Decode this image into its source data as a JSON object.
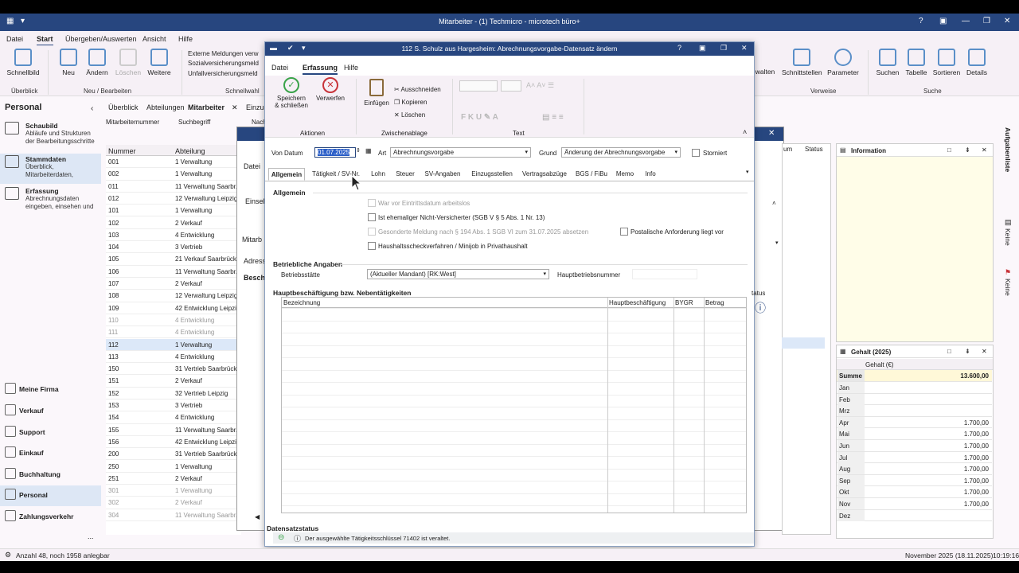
{
  "app": {
    "title": "Mitarbeiter - (1) Techmicro - microtech büro+",
    "menu": [
      "Datei",
      "Start",
      "Übergeben/Auswerten",
      "Ansicht",
      "Hilfe"
    ]
  },
  "ribbon": {
    "buttons": [
      {
        "label": "Schnellbild"
      },
      {
        "label": "Neu"
      },
      {
        "label": "Ändern"
      },
      {
        "label": "Löschen"
      },
      {
        "label": "Weitere"
      }
    ],
    "small": [
      "Externe Meldungen verw",
      "Sozialversicherungsmeld",
      "Unfallversicherungsmeld"
    ],
    "groups": [
      "Überblick",
      "Neu / Bearbeiten",
      "Schnellwahl",
      "Verweise",
      "Suche"
    ],
    "right_buttons": [
      "walten",
      "Schnittstellen",
      "Parameter",
      "Suchen",
      "Tabelle",
      "Sortieren",
      "Details"
    ]
  },
  "sidebar": {
    "header": "Personal",
    "items": [
      {
        "title": "Schaubild",
        "sub": "Abläufe und Strukturen der Bearbeitungsschritte"
      },
      {
        "title": "Stammdaten",
        "sub": "Überblick, Mitarbeiterdaten,"
      },
      {
        "title": "Erfassung",
        "sub": "Abrechnungsdaten eingeben, einsehen und"
      }
    ],
    "nav": [
      "Meine Firma",
      "Verkauf",
      "Support",
      "Einkauf",
      "Buchhaltung",
      "Personal",
      "Zahlungsverkehr"
    ]
  },
  "list": {
    "tabs": [
      "Überblick",
      "Abteilungen",
      "Mitarbeiter",
      "Einzu"
    ],
    "filters": [
      "Mitarbeiternummer",
      "Suchbegriff",
      "Nach"
    ],
    "headers": [
      "Nummer",
      "Abteilung"
    ],
    "rows": [
      [
        "001",
        "1 Verwaltung"
      ],
      [
        "002",
        "1 Verwaltung"
      ],
      [
        "011",
        "11 Verwaltung Saarbr."
      ],
      [
        "012",
        "12 Verwaltung Leipzig"
      ],
      [
        "101",
        "1 Verwaltung"
      ],
      [
        "102",
        "2 Verkauf"
      ],
      [
        "103",
        "4 Entwicklung"
      ],
      [
        "104",
        "3 Vertrieb"
      ],
      [
        "105",
        "21 Verkauf Saarbrück"
      ],
      [
        "106",
        "11 Verwaltung Saarbr."
      ],
      [
        "107",
        "2 Verkauf"
      ],
      [
        "108",
        "12 Verwaltung Leipzig"
      ],
      [
        "109",
        "42 Entwicklung Leipzi"
      ],
      [
        "110",
        "4 Entwicklung"
      ],
      [
        "111",
        "4 Entwicklung"
      ],
      [
        "112",
        "1 Verwaltung"
      ],
      [
        "113",
        "4 Entwicklung"
      ],
      [
        "150",
        "31 Vertrieb Saarbrück"
      ],
      [
        "151",
        "2 Verkauf"
      ],
      [
        "152",
        "32 Vertrieb Leipzig"
      ],
      [
        "153",
        "3 Vertrieb"
      ],
      [
        "154",
        "4 Entwicklung"
      ],
      [
        "155",
        "11 Verwaltung Saarbr."
      ],
      [
        "156",
        "42 Entwicklung Leipzi"
      ],
      [
        "200",
        "31 Vertrieb Saarbrück"
      ],
      [
        "250",
        "1 Verwaltung"
      ],
      [
        "251",
        "2 Verkauf"
      ],
      [
        "301",
        "1 Verwaltung"
      ],
      [
        "302",
        "2 Verkauf"
      ],
      [
        "304",
        "11 Verwaltung Saarbr."
      ]
    ]
  },
  "dlg2": {
    "labels": [
      "Datei",
      "Einseh",
      "Mitarb",
      "Adress",
      "Besch"
    ],
    "cols": [
      "um",
      "Status"
    ],
    "status_col": "tatus"
  },
  "dialog": {
    "title": "112 S. Schulz aus Hargesheim: Abrechnungsvorgabe-Datensatz ändern",
    "menu": [
      "Datei",
      "Erfassung",
      "Hilfe"
    ],
    "ribbon": {
      "save": "Speichern\n& schließen",
      "discard": "Verwerfen",
      "paste": "Einfügen",
      "cut": "Ausschneiden",
      "copy": "Kopieren",
      "delete": "Löschen",
      "groups": [
        "Aktionen",
        "Zwischenablage",
        "Text"
      ]
    },
    "von_label": "Von Datum",
    "von_value": "01.07.2025",
    "art_label": "Art",
    "art_value": "Abrechnungsvorgabe",
    "grund_label": "Grund",
    "grund_value": "Änderung der Abrechnungsvorgabe",
    "storniert": "Storniert",
    "tabs": [
      "Allgemein",
      "Tätigkeit / SV-Nr.",
      "Lohn",
      "Steuer",
      "SV-Angaben",
      "Einzugsstellen",
      "Vertragsabzüge",
      "BGS / FiBu",
      "Memo",
      "Info"
    ],
    "section_general": "Allgemein",
    "checks": [
      "War vor Eintrittsdatum arbeitslos",
      "Ist ehemaliger Nicht-Versicherter (SGB V § 5 Abs. 1 Nr. 13)",
      "Gesonderte Meldung nach § 194 Abs. 1 SGB VI zum 31.07.2025 absetzen",
      "Haushaltsscheckverfahren / Minijob in Privathaushalt",
      "Postalische Anforderung liegt vor"
    ],
    "section_company": "Betriebliche Angaben",
    "betriebsstaette_label": "Betriebsstätte",
    "betriebsstaette_value": "(Aktueller Mandant) [RK:West]",
    "haupt_label": "Hauptbetriebsnummer",
    "section_jobs": "Hauptbeschäftigung bzw. Nebentätigkeiten",
    "table_headers": [
      "Bezeichnung",
      "Hauptbeschäftigung",
      "BYGR",
      "Betrag"
    ],
    "status_header": "Datensatzstatus",
    "status_msg": "Der ausgewählte Tätigkeitsschlüssel 71402 ist veraltet."
  },
  "info_panel": {
    "title": "Information"
  },
  "salary": {
    "title": "Gehalt (2025)",
    "col": "Gehalt (€)",
    "sum_label": "Summe",
    "sum": "13.600,00",
    "months": [
      [
        "Jan",
        ""
      ],
      [
        "Feb",
        ""
      ],
      [
        "Mrz",
        ""
      ],
      [
        "Apr",
        "1.700,00"
      ],
      [
        "Mai",
        "1.700,00"
      ],
      [
        "Jun",
        "1.700,00"
      ],
      [
        "Jul",
        "1.700,00"
      ],
      [
        "Aug",
        "1.700,00"
      ],
      [
        "Sep",
        "1.700,00"
      ],
      [
        "Okt",
        "1.700,00"
      ],
      [
        "Nov",
        "1.700,00"
      ],
      [
        "Dez",
        ""
      ]
    ]
  },
  "side_tabs": [
    "Aufgabenliste",
    "Keine",
    "Keine"
  ],
  "status": {
    "left": "Anzahl 48, noch 1958 anlegbar",
    "date": "November 2025  (18.11.2025)",
    "time": "10:19:16"
  }
}
